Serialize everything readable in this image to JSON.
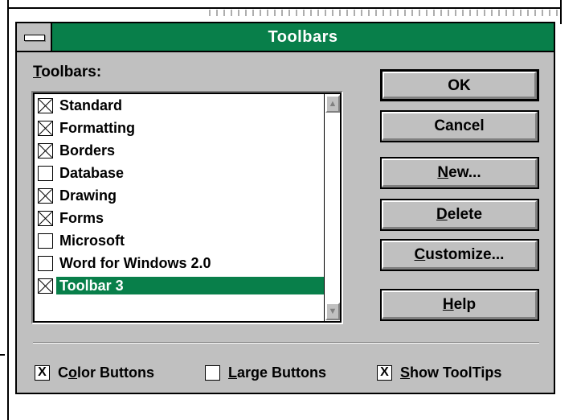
{
  "dialog": {
    "title": "Toolbars",
    "list_label": {
      "mnemonic": "T",
      "rest": "oolbars:"
    },
    "toolbars": [
      {
        "label": "Standard",
        "checked": true,
        "selected": false
      },
      {
        "label": "Formatting",
        "checked": true,
        "selected": false
      },
      {
        "label": "Borders",
        "checked": true,
        "selected": false
      },
      {
        "label": "Database",
        "checked": false,
        "selected": false
      },
      {
        "label": "Drawing",
        "checked": true,
        "selected": false
      },
      {
        "label": "Forms",
        "checked": true,
        "selected": false
      },
      {
        "label": "Microsoft",
        "checked": false,
        "selected": false
      },
      {
        "label": "Word for Windows 2.0",
        "checked": false,
        "selected": false
      },
      {
        "label": "Toolbar 3",
        "checked": true,
        "selected": true
      }
    ],
    "buttons": {
      "ok": "OK",
      "cancel": "Cancel",
      "new": {
        "mnemonic": "N",
        "rest": "ew..."
      },
      "delete": {
        "mnemonic": "D",
        "rest": "elete"
      },
      "customize": {
        "mnemonic": "C",
        "rest": "ustomize..."
      },
      "help": {
        "mnemonic": "H",
        "rest": "elp"
      }
    },
    "options": {
      "color_buttons": {
        "pre": "C",
        "mnemonic": "o",
        "rest": "lor Buttons",
        "checked": true,
        "mark": "X"
      },
      "large_buttons": {
        "pre": "",
        "mnemonic": "L",
        "rest": "arge Buttons",
        "checked": false,
        "mark": ""
      },
      "show_tooltips": {
        "pre": "",
        "mnemonic": "S",
        "rest": "how ToolTips",
        "checked": true,
        "mark": "X"
      }
    },
    "colors": {
      "titlebar": "#087f4a",
      "selection": "#087f4a",
      "face": "#c0c0c0"
    }
  }
}
